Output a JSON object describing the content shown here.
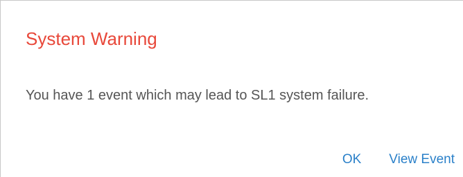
{
  "dialog": {
    "title": "System Warning",
    "message": "You have 1 event which may lead to SL1 system failure.",
    "ok_label": "OK",
    "view_event_label": "View Event"
  },
  "colors": {
    "title": "#e8483a",
    "message": "#555555",
    "action": "#2a80c9",
    "border": "#c8c8c8"
  }
}
